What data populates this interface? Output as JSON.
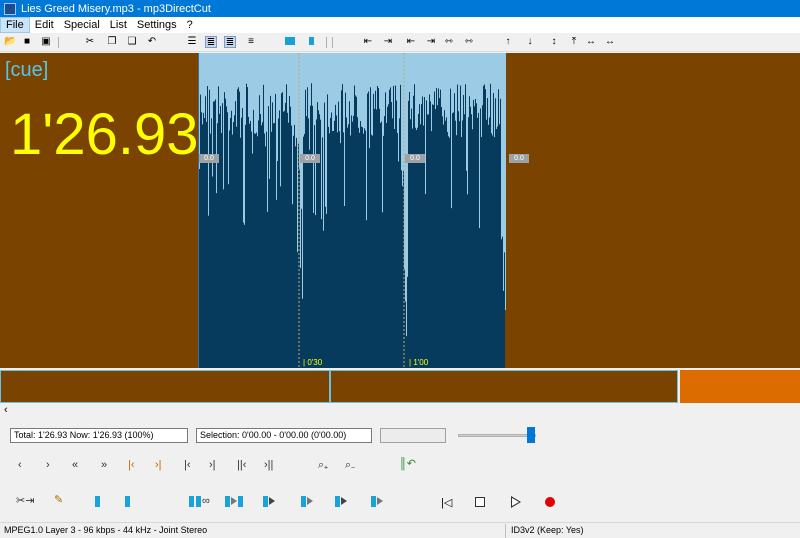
{
  "window": {
    "title": "Lies Greed Misery.mp3 - mp3DirectCut"
  },
  "menu": [
    "File",
    "Edit",
    "Special",
    "List",
    "Settings",
    "?"
  ],
  "toolbar": {
    "file_icons": [
      "open-icon",
      "save-icon",
      "save-all-icon"
    ],
    "edit_icons": [
      "cut-icon",
      "copy-icon",
      "paste-icon",
      "undo-icon"
    ],
    "view_icons": [
      "page-icon",
      "page-selected-icon",
      "page-cue-icon",
      "page-small-icon"
    ]
  },
  "waveform": {
    "cue_label": "[cue]",
    "time": "1'26.93",
    "levels": [
      "0.0",
      "0.0",
      "0.0",
      "0.0"
    ],
    "time_marks": [
      "0'30",
      "1'00"
    ]
  },
  "info": {
    "total": "Total: 1'26.93   Now: 1'26.93   (100%)",
    "selection": "Selection: 0'00.00 - 0'00.00 (0'00.00)",
    "volume_fraction": 0.93
  },
  "status": {
    "format": "MPEG1.0 Layer 3 - 96 kbps - 44 kHz - Joint Stereo",
    "tag": "ID3v2 (Keep: Yes)"
  },
  "colors": {
    "wave_bg": "#7a4300",
    "wave_panel": "#073b5e",
    "time": "#ffff00",
    "cue": "#55c5e8",
    "accent": "#0078d7"
  }
}
